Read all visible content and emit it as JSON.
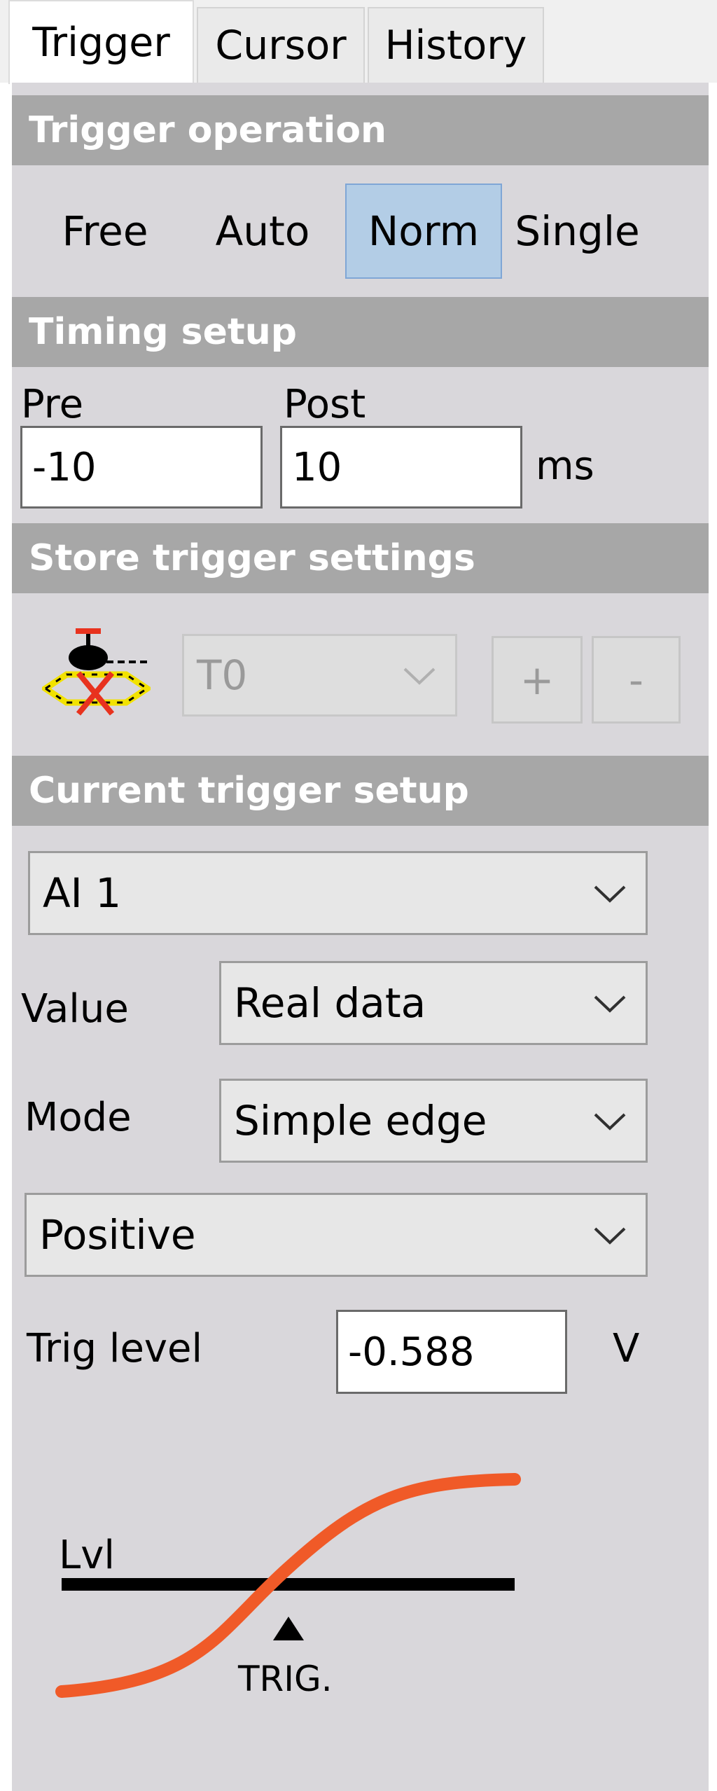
{
  "tabs": [
    {
      "label": "Trigger",
      "active": true
    },
    {
      "label": "Cursor",
      "active": false
    },
    {
      "label": "History",
      "active": false
    }
  ],
  "trigger_operation": {
    "title": "Trigger operation",
    "options": [
      "Free",
      "Auto",
      "Norm",
      "Single"
    ],
    "selected": "Norm"
  },
  "timing_setup": {
    "title": "Timing setup",
    "pre_label": "Pre",
    "pre_value": "-10",
    "post_label": "Post",
    "post_value": "10",
    "unit": "ms"
  },
  "store_trigger_settings": {
    "title": "Store trigger settings",
    "preset_value": "T0",
    "add_label": "+",
    "remove_label": "-"
  },
  "current_trigger_setup": {
    "title": "Current trigger setup",
    "channel": "AI 1",
    "value_label": "Value",
    "value_selected": "Real data",
    "mode_label": "Mode",
    "mode_selected": "Simple edge",
    "edge": "Positive",
    "trig_level_label": "Trig level",
    "trig_level_value": "-0.588",
    "trig_level_unit": "V"
  },
  "diagram": {
    "level_label": "Lvl",
    "trigger_label": "TRIG."
  },
  "colors": {
    "header_bg": "#a7a7a7",
    "panel_bg": "#d9d7db",
    "selected_bg": "#b3cde6",
    "curve": "#f05a28",
    "icon_yellow": "#f2e200",
    "icon_red": "#e8321e"
  }
}
